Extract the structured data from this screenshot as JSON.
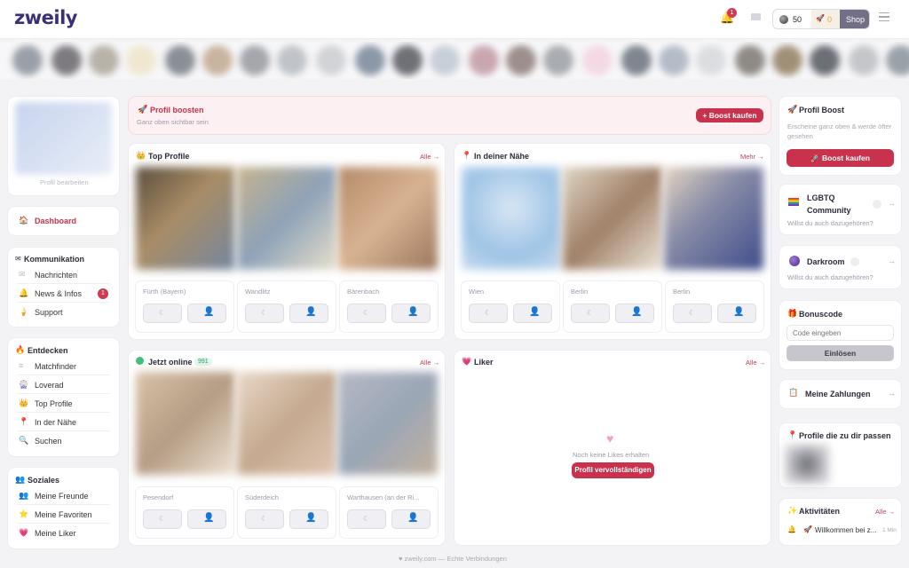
{
  "header": {
    "logo": "zweily",
    "notif_count": "1",
    "coins": "50",
    "bonus": "0",
    "shop": "Shop"
  },
  "profile": {
    "edit": "Profil bearbeiten"
  },
  "nav": {
    "dashboard": "Dashboard",
    "komm_title": "Kommunikation",
    "komm": [
      {
        "label": "Nachrichten",
        "icon": "envelope-icon"
      },
      {
        "label": "News & Infos",
        "icon": "bell-icon",
        "badge": "1"
      },
      {
        "label": "Support",
        "icon": "ice-cream-icon"
      }
    ],
    "ent_title": "Entdecken",
    "ent": [
      {
        "label": "Matchfinder",
        "icon": "lines-icon"
      },
      {
        "label": "Loverad",
        "icon": "wheel-icon"
      },
      {
        "label": "Top Profile",
        "icon": "crown-icon"
      },
      {
        "label": "In der Nähe",
        "icon": "pin-icon"
      },
      {
        "label": "Suchen",
        "icon": "search-icon"
      }
    ],
    "soz_title": "Soziales",
    "soz": [
      {
        "label": "Meine Freunde",
        "icon": "friends-icon"
      },
      {
        "label": "Meine Favoriten",
        "icon": "star-icon"
      },
      {
        "label": "Meine Liker",
        "icon": "heart-icon"
      }
    ]
  },
  "boost_banner": {
    "title": "Profil boosten",
    "sub": "Ganz oben sichtbar sein",
    "btn": "+ Boost kaufen"
  },
  "top": {
    "title": "Top Profile",
    "more": "Alle →",
    "cities": [
      "Fürth (Bayern)",
      "Wandlitz",
      "Bärenbach"
    ]
  },
  "near": {
    "title": "In deiner Nähe",
    "more": "Mehr →",
    "cities": [
      "Wien",
      "Berlin",
      "Berlin"
    ]
  },
  "online": {
    "title": "Jetzt online",
    "count": "991",
    "more": "Alle →",
    "cities": [
      "Pesendorf",
      "Süderdeich",
      "Warthausen (an der Ri..."
    ]
  },
  "liker": {
    "title": "Liker",
    "more": "Alle →",
    "empty": "Noch keine Likes erhalten",
    "btn": "Profil vervollständigen"
  },
  "right": {
    "boost": {
      "title": "Profil Boost",
      "desc": "Erscheine ganz oben & werde öfter gesehen",
      "btn": "Boost kaufen"
    },
    "lgbtq": {
      "title1": "LGBTQ",
      "title2": "Community",
      "sub": "Willst du auch dazugehören?"
    },
    "dark": {
      "title": "Darkroom",
      "sub": "Willst du auch dazugehören?"
    },
    "bonus": {
      "title": "Bonuscode",
      "placeholder": "Code eingeben",
      "btn": "Einlösen"
    },
    "pay": {
      "title": "Meine Zahlungen"
    },
    "match": {
      "title": "Profile die zu dir passen"
    },
    "act": {
      "title": "Aktivitäten",
      "more": "Alle →",
      "item": "Willkommen bei z...",
      "time": "1 Min"
    }
  },
  "footer": "zweily.com — Echte Verbindungen"
}
